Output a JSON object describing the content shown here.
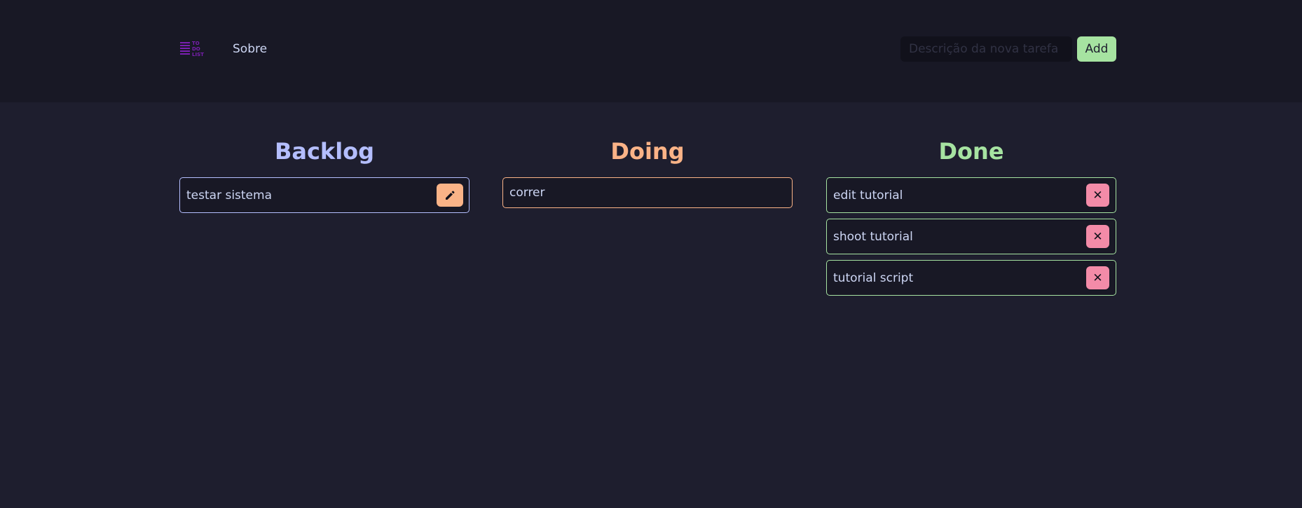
{
  "header": {
    "logo_text_lines": [
      "TO",
      "DO",
      "LIST"
    ],
    "nav_about": "Sobre",
    "new_task_placeholder": "Descrição da nova tarefa",
    "new_task_value": "",
    "add_label": "Add"
  },
  "colors": {
    "backlog": "#b4befe",
    "doing": "#fab387",
    "done": "#a6e3a1",
    "remove_button": "#f38ba8",
    "logo": "#7a1fb0"
  },
  "columns": {
    "backlog": {
      "title": "Backlog",
      "tasks": [
        {
          "text": "testar sistema",
          "action_icon": "pencil-icon"
        }
      ]
    },
    "doing": {
      "title": "Doing",
      "tasks": [
        {
          "text": "correr"
        }
      ]
    },
    "done": {
      "title": "Done",
      "tasks": [
        {
          "text": "edit tutorial",
          "action_icon": "close-icon",
          "action_glyph": "✕"
        },
        {
          "text": "shoot tutorial",
          "action_icon": "close-icon",
          "action_glyph": "✕"
        },
        {
          "text": "tutorial script",
          "action_icon": "close-icon",
          "action_glyph": "✕"
        }
      ]
    }
  }
}
